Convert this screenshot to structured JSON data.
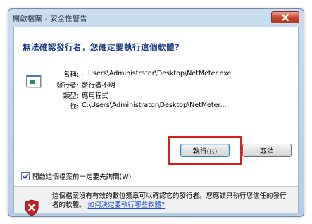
{
  "window": {
    "title": "開啟檔案 - 安全性警告"
  },
  "dialog": {
    "question": "無法確認發行者，您確定要執行這個軟體?",
    "fields": [
      {
        "label": "名稱:",
        "value": "...Users\\Administrator\\Desktop\\NetMeter.exe"
      },
      {
        "label": "發行者:",
        "value": "發行者不明"
      },
      {
        "label": "類型:",
        "value": "應用程式"
      },
      {
        "label": "從:",
        "value": "C:\\Users\\Administrator\\Desktop\\NetMeter..."
      }
    ],
    "buttons": {
      "run": "執行(R)",
      "cancel": "取消"
    },
    "checkbox": {
      "label": "開啟這個檔案前一定要先詢問(W)",
      "checked": true
    },
    "warning": {
      "text": "這個檔案沒有有效的數位簽章可以確認它的發行者。您應該只執行您信任的發行者的軟體。",
      "link": "如何決定要執行哪些軟體?"
    }
  },
  "colors": {
    "highlight": "#e11b1b",
    "question_text": "#1a3b86",
    "link": "#1a4fd8"
  }
}
